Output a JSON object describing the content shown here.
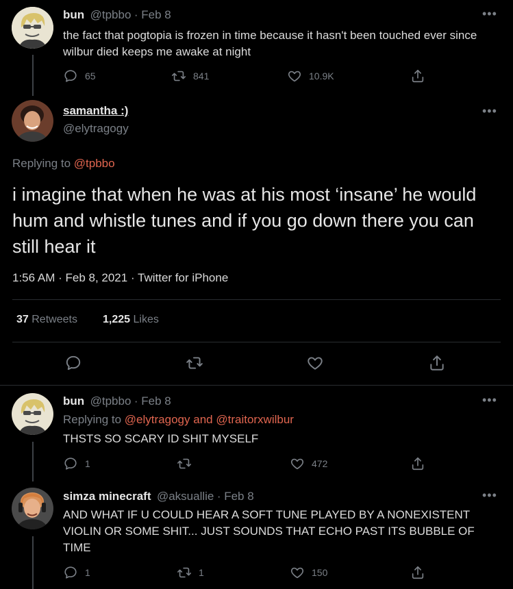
{
  "tweet1": {
    "name": "bun",
    "handle": "@tpbbo",
    "date": "· Feb 8",
    "text": "the fact that pogtopia is frozen in time because it hasn't been touched ever since wilbur died keeps me awake at night",
    "replies": "65",
    "retweets": "841",
    "likes": "10.9K"
  },
  "main": {
    "name": "samantha :)",
    "handle": "@elytragogy",
    "replying_prefix": "Replying to",
    "replying_to": "@tpbbo",
    "text": "i imagine that when he was at his most ‘insane’ he would hum and whistle tunes and if you go down there you can still hear it",
    "meta": "1:56 AM · Feb 8, 2021 · Twitter for iPhone",
    "retweets_count": "37",
    "retweets_label": "Retweets",
    "likes_count": "1,225",
    "likes_label": "Likes"
  },
  "reply1": {
    "name": "bun",
    "handle": "@tpbbo",
    "date": "· Feb 8",
    "replying_prefix": "Replying to",
    "replying_to_1": "@elytragogy",
    "replying_and": "and",
    "replying_to_2": "@traitorxwilbur",
    "text": "THSTS SO SCARY ID SHIT MYSELF",
    "replies": "1",
    "retweets": "",
    "likes": "472"
  },
  "reply2": {
    "name": "simza minecraft",
    "handle": "@aksuallie",
    "date": "· Feb 8",
    "text": "AND WHAT IF U COULD HEAR A SOFT TUNE PLAYED BY A NONEXISTENT VIOLIN OR SOME SHIT... JUST SOUNDS THAT ECHO PAST ITS BUBBLE OF TIME",
    "replies": "1",
    "retweets": "1",
    "likes": "150"
  },
  "more_label": "•••",
  "icons": [
    "reply-icon",
    "retweet-icon",
    "like-icon",
    "share-icon",
    "more-icon"
  ],
  "colors": {
    "background": "#000000",
    "link": "#e0654f",
    "muted": "#7b8087",
    "text": "#d9d9d9"
  }
}
